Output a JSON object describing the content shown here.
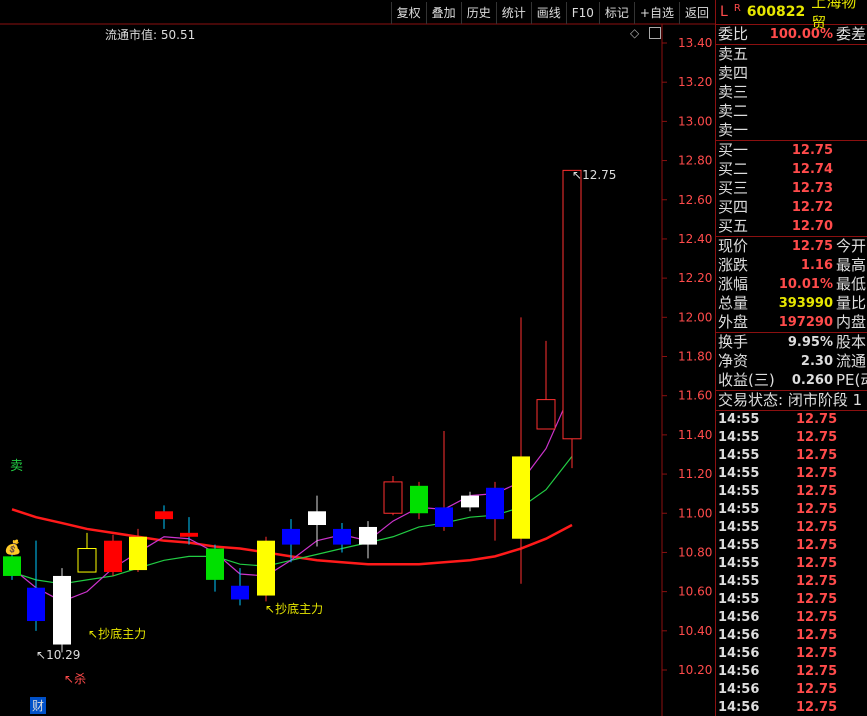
{
  "toolbar": {
    "buttons": [
      "复权",
      "叠加",
      "历史",
      "统计",
      "画线",
      "F10",
      "标记",
      "+自选",
      "返回"
    ]
  },
  "chart": {
    "float_cap_label": "流通市值: 50.51",
    "high_label": "12.75",
    "low_label": "10.29",
    "signal_sell": "卖",
    "signal_kill": "杀",
    "signal_bottom_1": "抄底主力",
    "signal_bottom_2": "抄底主力",
    "signal_cai": "财",
    "y_ticks": [
      "13.40",
      "13.20",
      "13.00",
      "12.80",
      "12.60",
      "12.40",
      "12.20",
      "12.00",
      "11.80",
      "11.60",
      "11.40",
      "11.20",
      "11.00",
      "10.80",
      "10.60",
      "10.40",
      "10.20"
    ],
    "colors": {
      "up": "#ff3030",
      "down": "#00c8ff",
      "ma_slow": "#ff1a1a",
      "ma_mid": "#22cc44",
      "ma_fast": "#cc33cc",
      "axis": "#8b1010"
    }
  },
  "chart_data": {
    "type": "candlestick",
    "ylim": [
      10.1,
      13.5
    ],
    "candles": [
      {
        "o": 10.78,
        "h": 10.82,
        "l": 10.66,
        "c": 10.68,
        "fill": "#00e000"
      },
      {
        "o": 10.62,
        "h": 10.86,
        "l": 10.4,
        "c": 10.45,
        "fill": "#0000ff"
      },
      {
        "o": 10.33,
        "h": 10.72,
        "l": 10.29,
        "c": 10.68,
        "fill": "#ffffff"
      },
      {
        "o": 10.7,
        "h": 10.9,
        "l": 10.7,
        "c": 10.82,
        "fill": "#000000",
        "stroke": "#ffff00"
      },
      {
        "o": 10.7,
        "h": 10.89,
        "l": 10.68,
        "c": 10.86,
        "fill": "#ff0000"
      },
      {
        "o": 10.71,
        "h": 10.92,
        "l": 10.7,
        "c": 10.88,
        "fill": "#ffff00"
      },
      {
        "o": 11.01,
        "h": 11.04,
        "l": 10.92,
        "c": 10.97,
        "fill": "#ff0000"
      },
      {
        "o": 10.9,
        "h": 10.98,
        "l": 10.84,
        "c": 10.88,
        "fill": "#ff0000"
      },
      {
        "o": 10.82,
        "h": 10.84,
        "l": 10.6,
        "c": 10.66,
        "fill": "#00e000"
      },
      {
        "o": 10.63,
        "h": 10.72,
        "l": 10.53,
        "c": 10.56,
        "fill": "#0000ff"
      },
      {
        "o": 10.58,
        "h": 10.88,
        "l": 10.55,
        "c": 10.86,
        "fill": "#ffff00"
      },
      {
        "o": 10.92,
        "h": 10.97,
        "l": 10.75,
        "c": 10.84,
        "fill": "#0000ff"
      },
      {
        "o": 10.94,
        "h": 11.09,
        "l": 10.83,
        "c": 11.01,
        "fill": "#ffffff"
      },
      {
        "o": 10.92,
        "h": 10.95,
        "l": 10.8,
        "c": 10.84,
        "fill": "#0000ff"
      },
      {
        "o": 10.84,
        "h": 10.96,
        "l": 10.77,
        "c": 10.93,
        "fill": "#ffffff"
      },
      {
        "o": 11.0,
        "h": 11.19,
        "l": 10.99,
        "c": 11.16,
        "fill": "#000000",
        "stroke": "#ff3030"
      },
      {
        "o": 11.0,
        "h": 11.16,
        "l": 10.97,
        "c": 11.14,
        "fill": "#00e000"
      },
      {
        "o": 10.93,
        "h": 11.42,
        "l": 10.91,
        "c": 11.03,
        "fill": "#0000ff"
      },
      {
        "o": 11.03,
        "h": 11.11,
        "l": 11.01,
        "c": 11.09,
        "fill": "#ffffff"
      },
      {
        "o": 10.97,
        "h": 11.16,
        "l": 10.86,
        "c": 11.13,
        "fill": "#0000ff"
      },
      {
        "o": 10.87,
        "h": 12.0,
        "l": 10.64,
        "c": 11.29,
        "fill": "#ffff00"
      },
      {
        "o": 11.43,
        "h": 11.88,
        "l": 11.43,
        "c": 11.58,
        "fill": "#000000",
        "stroke": "#ff3030"
      },
      {
        "o": 11.38,
        "h": 12.75,
        "l": 11.23,
        "c": 12.75,
        "fill": "#000000",
        "stroke": "#ff3030"
      }
    ],
    "ma_slow": [
      11.02,
      10.98,
      10.95,
      10.92,
      10.9,
      10.88,
      10.86,
      10.85,
      10.83,
      10.82,
      10.8,
      10.78,
      10.76,
      10.75,
      10.74,
      10.74,
      10.74,
      10.75,
      10.76,
      10.78,
      10.82,
      10.87,
      10.94
    ],
    "ma_mid": [
      10.7,
      10.66,
      10.64,
      10.66,
      10.68,
      10.72,
      10.76,
      10.78,
      10.78,
      10.74,
      10.73,
      10.76,
      10.79,
      10.82,
      10.85,
      10.88,
      10.93,
      10.95,
      10.98,
      10.99,
      11.03,
      11.12,
      11.29
    ],
    "ma_fast": [
      10.72,
      10.62,
      10.55,
      10.6,
      10.72,
      10.8,
      10.88,
      10.87,
      10.8,
      10.69,
      10.68,
      10.76,
      10.86,
      10.89,
      10.86,
      10.96,
      11.03,
      11.02,
      11.09,
      11.1,
      11.16,
      11.33,
      11.63
    ]
  },
  "panel": {
    "header": {
      "flag": "L",
      "r": "R",
      "code": "600822",
      "name": "上海物贸"
    },
    "webi": {
      "label": "委比",
      "value": "100.00%",
      "extra": "委差"
    },
    "asks": [
      {
        "label": "卖五"
      },
      {
        "label": "卖四"
      },
      {
        "label": "卖三"
      },
      {
        "label": "卖二"
      },
      {
        "label": "卖一"
      }
    ],
    "bids": [
      {
        "label": "买一",
        "price": "12.75"
      },
      {
        "label": "买二",
        "price": "12.74"
      },
      {
        "label": "买三",
        "price": "12.73"
      },
      {
        "label": "买四",
        "price": "12.72"
      },
      {
        "label": "买五",
        "price": "12.70"
      }
    ],
    "quote": [
      {
        "label": "现价",
        "value": "12.75",
        "extra": "今开",
        "cls": "red"
      },
      {
        "label": "涨跌",
        "value": "1.16",
        "extra": "最高",
        "cls": "red"
      },
      {
        "label": "涨幅",
        "value": "10.01%",
        "extra": "最低",
        "cls": "red"
      },
      {
        "label": "总量",
        "value": "393990",
        "extra": "量比",
        "cls": "yel"
      },
      {
        "label": "外盘",
        "value": "197290",
        "extra": "内盘",
        "cls": "red"
      }
    ],
    "fund": [
      {
        "label": "换手",
        "value": "9.95%",
        "extra": "股本"
      },
      {
        "label": "净资",
        "value": "2.30",
        "extra": "流通"
      },
      {
        "label": "收益(三)",
        "value": "0.260",
        "extra": "PE(动"
      }
    ],
    "trade_status": "交易状态: 闭市阶段 1",
    "ticks": [
      {
        "t": "14:55",
        "p": "12.75"
      },
      {
        "t": "14:55",
        "p": "12.75"
      },
      {
        "t": "14:55",
        "p": "12.75"
      },
      {
        "t": "14:55",
        "p": "12.75"
      },
      {
        "t": "14:55",
        "p": "12.75"
      },
      {
        "t": "14:55",
        "p": "12.75"
      },
      {
        "t": "14:55",
        "p": "12.75"
      },
      {
        "t": "14:55",
        "p": "12.75"
      },
      {
        "t": "14:55",
        "p": "12.75"
      },
      {
        "t": "14:55",
        "p": "12.75"
      },
      {
        "t": "14:55",
        "p": "12.75"
      },
      {
        "t": "14:56",
        "p": "12.75"
      },
      {
        "t": "14:56",
        "p": "12.75"
      },
      {
        "t": "14:56",
        "p": "12.75"
      },
      {
        "t": "14:56",
        "p": "12.75"
      },
      {
        "t": "14:56",
        "p": "12.75"
      },
      {
        "t": "14:56",
        "p": "12.75"
      }
    ]
  }
}
